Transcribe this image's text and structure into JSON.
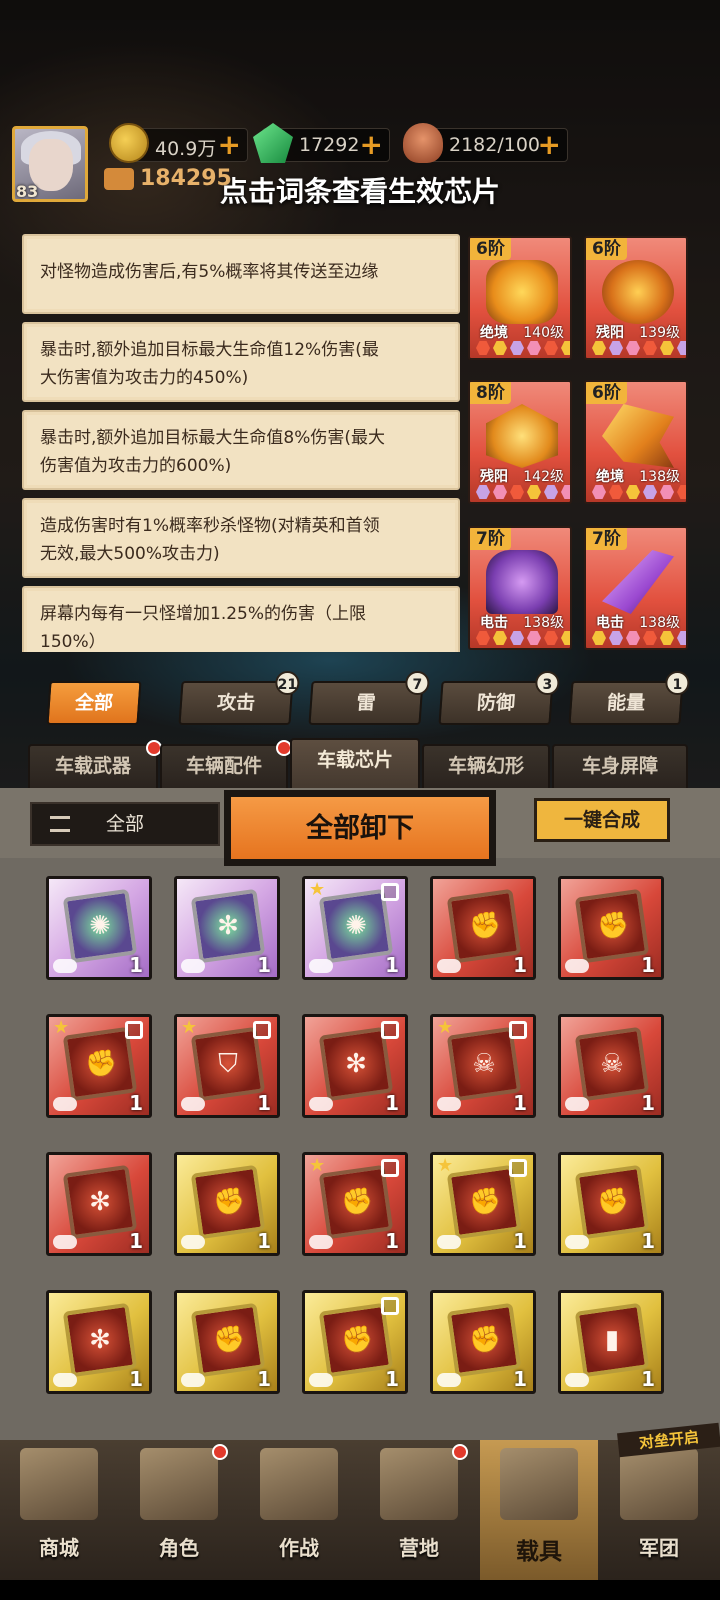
{
  "resources": {
    "level": "83",
    "gold": "40.9万",
    "gems": "17292",
    "stamina": "2182/100",
    "power": "184295"
  },
  "title": "点击词条查看生效芯片",
  "affixes": [
    {
      "lines": [
        "对怪物造成伤害后,有5%概率将其传送至边缘"
      ]
    },
    {
      "lines": [
        "暴击时,额外追加目标最大生命值12%伤害(最",
        "大伤害值为攻击力的450%)"
      ]
    },
    {
      "lines": [
        "暴击时,额外追加目标最大生命值8%伤害(最大",
        "伤害值为攻击力的600%)"
      ]
    },
    {
      "lines": [
        "造成伤害时有1%概率秒杀怪物(对精英和首领",
        "无效,最大500%攻击力)"
      ]
    },
    {
      "lines": [
        "屏幕内每有一只怪增加1.25%的伤害（上限",
        "150%）"
      ]
    }
  ],
  "effective_chips": [
    {
      "tier": "6阶",
      "name": "绝境",
      "level": "140级",
      "icon": "orange-cannon-icon"
    },
    {
      "tier": "6阶",
      "name": "残阳",
      "level": "139级",
      "icon": "orange-wheel-icon"
    },
    {
      "tier": "8阶",
      "name": "残阳",
      "level": "142级",
      "icon": "orange-armor-icon"
    },
    {
      "tier": "6阶",
      "name": "绝境",
      "level": "138级",
      "icon": "spiked-drill-icon"
    },
    {
      "tier": "7阶",
      "name": "电击",
      "level": "138级",
      "icon": "purple-twin-cannon-icon"
    },
    {
      "tier": "7阶",
      "name": "电击",
      "level": "138级",
      "icon": "purple-drill-icon"
    }
  ],
  "category_tabs": [
    {
      "label": "全部",
      "badge": ""
    },
    {
      "label": "攻击",
      "badge": "21"
    },
    {
      "label": "雷",
      "badge": "7"
    },
    {
      "label": "防御",
      "badge": "3"
    },
    {
      "label": "能量",
      "badge": "1"
    }
  ],
  "equipment_tabs": [
    "车载武器",
    "车辆配件",
    "车载芯片",
    "车辆幻形",
    "车身屏障"
  ],
  "toolbar": {
    "filter_label": "全部",
    "unequip_label": "全部卸下",
    "synth_label": "一键合成"
  },
  "inventory": [
    {
      "rarity": "purple",
      "count": "1",
      "star": false,
      "locked": false,
      "glyph": "flame-icon"
    },
    {
      "rarity": "purple",
      "count": "1",
      "star": false,
      "locked": false,
      "glyph": "gear-icon"
    },
    {
      "rarity": "purple",
      "count": "1",
      "star": true,
      "locked": true,
      "glyph": "flame-icon"
    },
    {
      "rarity": "red",
      "count": "1",
      "star": false,
      "locked": false,
      "glyph": "fist-icon"
    },
    {
      "rarity": "red",
      "count": "1",
      "star": false,
      "locked": false,
      "glyph": "fist-icon"
    },
    {
      "rarity": "red",
      "count": "1",
      "star": true,
      "locked": true,
      "glyph": "fist-icon"
    },
    {
      "rarity": "red",
      "count": "1",
      "star": true,
      "locked": true,
      "glyph": "shield-icon"
    },
    {
      "rarity": "red",
      "count": "1",
      "star": false,
      "locked": true,
      "glyph": "gear-icon"
    },
    {
      "rarity": "red",
      "count": "1",
      "star": true,
      "locked": true,
      "glyph": "skull-icon"
    },
    {
      "rarity": "red",
      "count": "1",
      "star": false,
      "locked": false,
      "glyph": "skull-icon"
    },
    {
      "rarity": "red",
      "count": "1",
      "star": false,
      "locked": false,
      "glyph": "gear-icon"
    },
    {
      "rarity": "gold",
      "count": "1",
      "star": false,
      "locked": false,
      "glyph": "fist-icon"
    },
    {
      "rarity": "red",
      "count": "1",
      "star": true,
      "locked": true,
      "glyph": "fist-icon"
    },
    {
      "rarity": "gold",
      "count": "1",
      "star": true,
      "locked": true,
      "glyph": "fist-icon"
    },
    {
      "rarity": "gold",
      "count": "1",
      "star": false,
      "locked": false,
      "glyph": "fist-icon"
    },
    {
      "rarity": "gold",
      "count": "1",
      "star": false,
      "locked": false,
      "glyph": "gear-icon"
    },
    {
      "rarity": "gold",
      "count": "1",
      "star": false,
      "locked": false,
      "glyph": "fist-icon"
    },
    {
      "rarity": "gold",
      "count": "1",
      "star": false,
      "locked": true,
      "glyph": "fist-icon"
    },
    {
      "rarity": "gold",
      "count": "1",
      "star": false,
      "locked": false,
      "glyph": "fist-icon"
    },
    {
      "rarity": "gold",
      "count": "1",
      "star": false,
      "locked": false,
      "glyph": "bullet-icon"
    }
  ],
  "bottom_nav": [
    {
      "label": "商城",
      "icon": "cart-icon",
      "dot": false,
      "active": false
    },
    {
      "label": "角色",
      "icon": "character-icon",
      "dot": true,
      "active": false
    },
    {
      "label": "作战",
      "icon": "guns-icon",
      "dot": false,
      "active": false
    },
    {
      "label": "营地",
      "icon": "tent-icon",
      "dot": true,
      "active": false
    },
    {
      "label": "载具",
      "icon": "vehicle-icon",
      "dot": false,
      "active": true
    },
    {
      "label": "军团",
      "icon": "legion-icon",
      "dot": false,
      "active": false
    }
  ],
  "nav_ribbon": "对垒开启",
  "colors": {
    "accent_orange": "#e6741f",
    "chip_red": "#e2513f",
    "tier_gold": "#f2b43b",
    "affix_bg": "#f2e2c2",
    "dot_colors": [
      "#f05a3b",
      "#f5c43a",
      "#c7a3e6",
      "#f28fb5"
    ]
  }
}
